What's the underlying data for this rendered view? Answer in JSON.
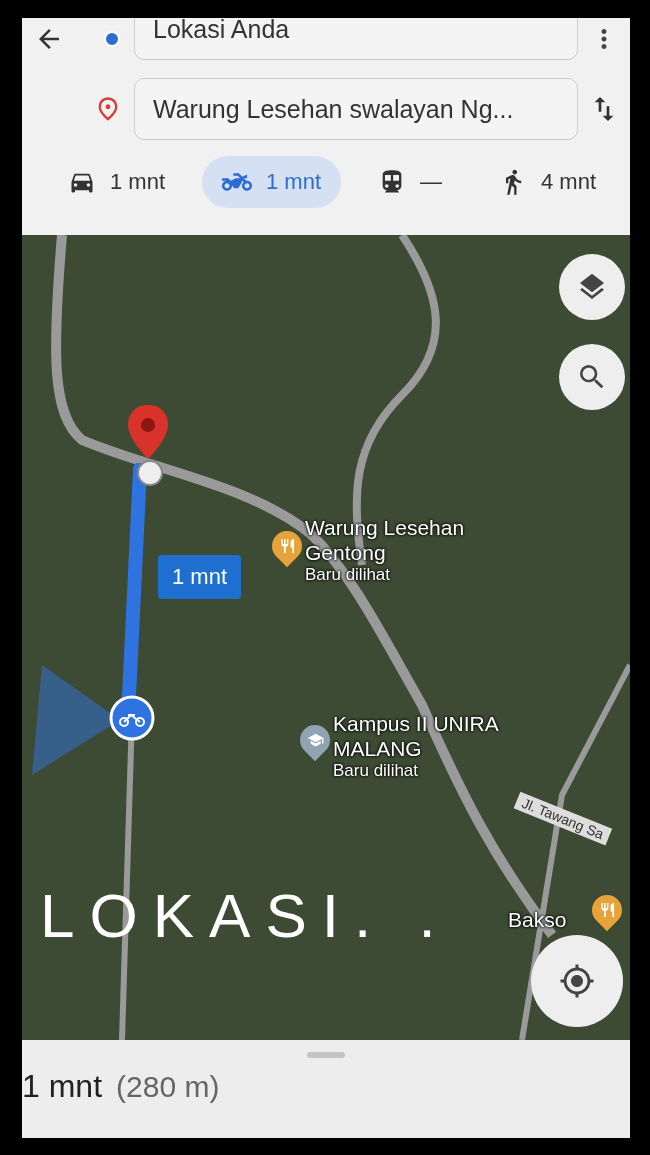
{
  "header": {
    "origin": "Lokasi Anda",
    "destination": "Warung Lesehan swalayan Ng..."
  },
  "modes": [
    {
      "kind": "car",
      "label": "1 mnt",
      "selected": false
    },
    {
      "kind": "motorbike",
      "label": "1 mnt",
      "selected": true
    },
    {
      "kind": "transit",
      "label": "—",
      "selected": false
    },
    {
      "kind": "walk",
      "label": "4 mnt",
      "selected": false
    }
  ],
  "map": {
    "route_label": "1 mnt",
    "street": "Jl. Tawang Sa",
    "places": [
      {
        "kind": "restaurant",
        "name": "Warung Lesehan Gentong",
        "note": "Baru dilihat"
      },
      {
        "kind": "school",
        "name": "Kampus II UNIRA MALANG",
        "note": "Baru dilihat"
      },
      {
        "kind": "restaurant",
        "name": "Bakso"
      }
    ]
  },
  "caption": "LOKASI. .",
  "sheet": {
    "duration": "1 mnt",
    "distance": "(280 m)"
  }
}
